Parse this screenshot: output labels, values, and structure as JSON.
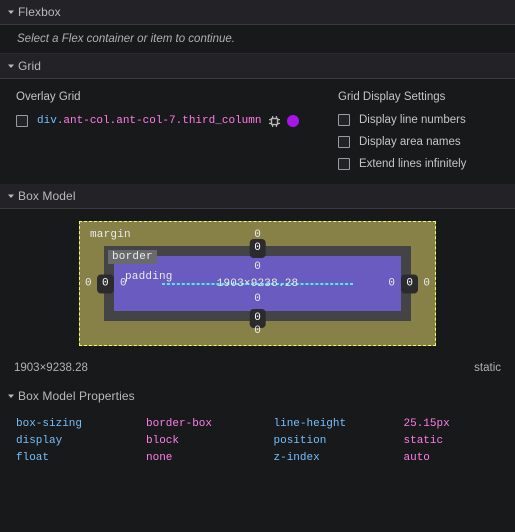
{
  "sections": {
    "flexbox": {
      "title": "Flexbox",
      "expanded_icon": "triangle-down-icon",
      "message": "Select a Flex container or item to continue."
    },
    "grid": {
      "title": "Grid",
      "overlay_grid_label": "Overlay Grid",
      "grid_item": {
        "tag": "div",
        "classes": ".ant-col.ant-col-7.third_column",
        "full_selector": "div.ant-col.ant-col-7.third_column",
        "checked": false,
        "settings_icon": "grid-target-icon",
        "swatch_color": "#a716e8"
      },
      "display_settings_label": "Grid Display Settings",
      "display_settings": [
        {
          "label": "Display line numbers",
          "checked": false
        },
        {
          "label": "Display area names",
          "checked": false
        },
        {
          "label": "Extend lines infinitely",
          "checked": false
        }
      ]
    },
    "box_model": {
      "title": "Box Model",
      "labels": {
        "margin": "margin",
        "border": "border",
        "padding": "padding"
      },
      "content_size": "1903×9238.28",
      "margin": {
        "top": "0",
        "right": "0",
        "bottom": "0",
        "left": "0"
      },
      "border": {
        "top": "0",
        "right": "0",
        "bottom": "0",
        "left": "0"
      },
      "padding": {
        "top": "0",
        "right": "0",
        "bottom": "0",
        "left": "0"
      },
      "info": {
        "size": "1903×9238.28",
        "position": "static"
      },
      "colors": {
        "margin_fill": "#888147",
        "margin_dash": "#edff64",
        "border_fill": "#444447",
        "padding_fill": "#6a5bc1",
        "content_fill": "#3681ab",
        "content_dash": "#68d9ff"
      }
    },
    "box_model_properties": {
      "title": "Box Model Properties",
      "left_column": [
        {
          "name": "box-sizing",
          "value": "border-box"
        },
        {
          "name": "display",
          "value": "block"
        },
        {
          "name": "float",
          "value": "none"
        }
      ],
      "right_column": [
        {
          "name": "line-height",
          "value": "25.15px"
        },
        {
          "name": "position",
          "value": "static"
        },
        {
          "name": "z-index",
          "value": "auto"
        }
      ]
    }
  }
}
